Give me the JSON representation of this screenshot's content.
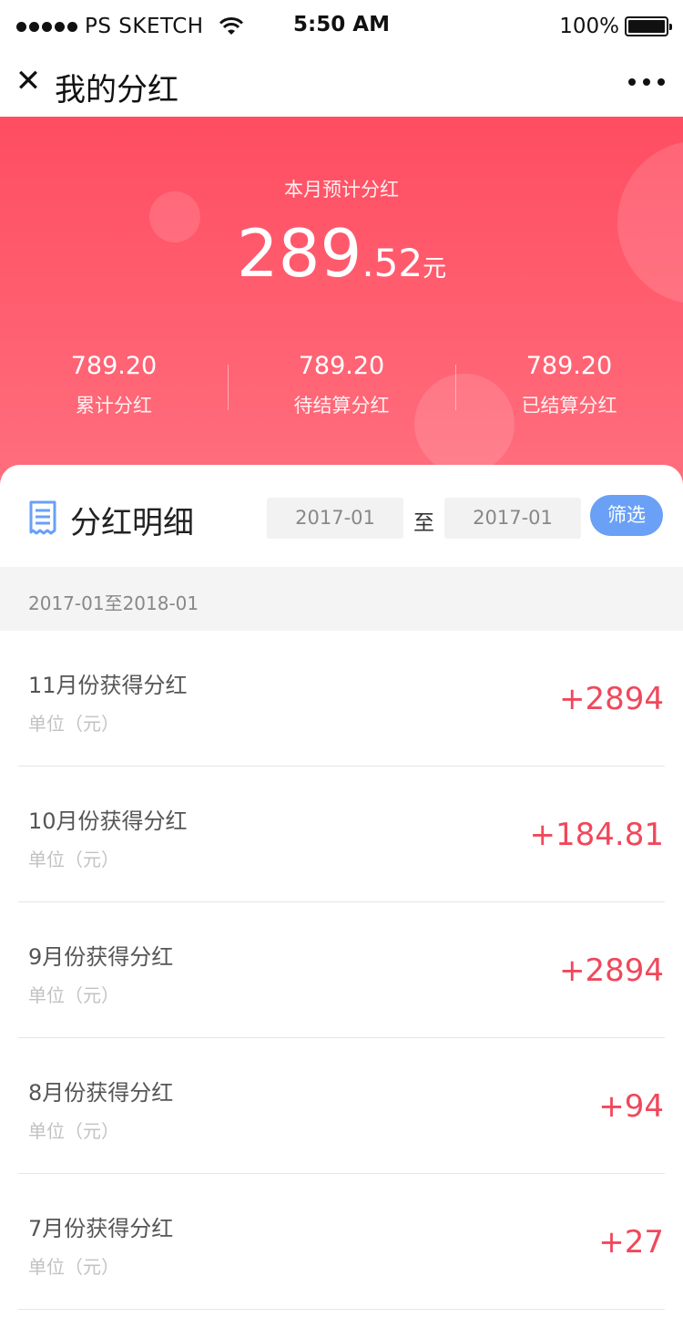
{
  "status_bar": {
    "carrier": "PS SKETCH",
    "time": "5:50 AM",
    "battery": "100%"
  },
  "nav": {
    "close_glyph": "✕",
    "title": "我的分红",
    "more_icon": "more-dots-icon"
  },
  "hero": {
    "label": "本月预计分红",
    "amount_integer": "289",
    "amount_decimal": ".52",
    "amount_unit": "元",
    "stats": [
      {
        "value": "789.20",
        "label": "累计分红"
      },
      {
        "value": "789.20",
        "label": "待结算分红"
      },
      {
        "value": "789.20",
        "label": "已结算分红"
      }
    ],
    "gradient_top": "#ff4d61",
    "gradient_bottom": "#ff6f7e"
  },
  "detail": {
    "icon": "document-icon",
    "title": "分红明细",
    "start_date": "2017-01",
    "to_label": "至",
    "end_date": "2017-01",
    "filter_label": "筛选",
    "filter_color": "#6aa0f6",
    "range_text": "2017-01至2018-01"
  },
  "items": [
    {
      "title": "11月份获得分红",
      "unit": "单位（元）",
      "amount": "+2894"
    },
    {
      "title": "10月份获得分红",
      "unit": "单位（元）",
      "amount": "+184.81"
    },
    {
      "title": "9月份获得分红",
      "unit": "单位（元）",
      "amount": "+2894"
    },
    {
      "title": "8月份获得分红",
      "unit": "单位（元）",
      "amount": "+94"
    },
    {
      "title": "7月份获得分红",
      "unit": "单位（元）",
      "amount": "+27"
    }
  ],
  "amount_color": "#f0485b"
}
